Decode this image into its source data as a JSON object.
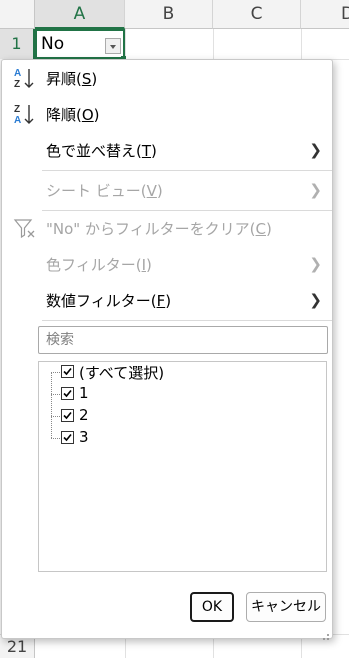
{
  "sheet": {
    "columns": [
      "A",
      "B",
      "C",
      "D"
    ],
    "rows": [
      "1",
      "21"
    ],
    "cell_a1": "No"
  },
  "menu": {
    "sort_asc": {
      "label": "昇順(",
      "key": "S",
      "end": ")"
    },
    "sort_desc": {
      "label": "降順(",
      "key": "O",
      "end": ")"
    },
    "sort_by_color": {
      "label": "色で並べ替え(",
      "key": "T",
      "end": ")"
    },
    "sheet_view": {
      "label": "シート ビュー(",
      "key": "V",
      "end": ")"
    },
    "clear_filter": {
      "label": "\"No\" からフィルターをクリア(",
      "key": "C",
      "end": ")"
    },
    "color_filter": {
      "label": "色フィルター(",
      "key": "I",
      "end": ")"
    },
    "number_filter": {
      "label": "数値フィルター(",
      "key": "F",
      "end": ")"
    }
  },
  "search": {
    "placeholder": "検索"
  },
  "list": {
    "items": [
      "(すべて選択)",
      "1",
      "2",
      "3"
    ]
  },
  "buttons": {
    "ok": "OK",
    "cancel": "キャンセル"
  }
}
